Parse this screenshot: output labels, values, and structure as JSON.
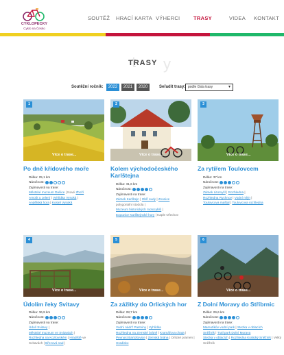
{
  "logo": {
    "text": "CYKLOPECKY",
    "subtext": "Cyklo na Česko"
  },
  "nav": [
    "SOUTĚŽ",
    "HRACÍ KARTA",
    "VÝHERCI",
    "TRASY",
    "VIDEA",
    "KONTAKT"
  ],
  "nav_active": "TRASY",
  "colors": {
    "bar1": "#f0d020",
    "bar2": "#c4143c",
    "bar3": "#1fb86a",
    "accent": "#2a8fd6",
    "active_nav": "#c4143c"
  },
  "page_title": "TRASY",
  "filters": {
    "year_label": "Soutěžní ročník:",
    "years": [
      "2022",
      "2021",
      "2020"
    ],
    "active_year": "2022",
    "sort_label": "Seřadit trasy:",
    "sort_value": "podle čísla trasy"
  },
  "cards": [
    {
      "number": "1",
      "more": "Více o trase...",
      "title": "Po dně křídového moře",
      "length": "Délka: 25,1 km",
      "difficulty_label": "Náročnost:",
      "difficulty": 2,
      "sights_label": "Zajímavosti na trase:",
      "sights": [
        [
          {
            "t": "Městské muzeum Dašice",
            "l": true
          },
          {
            "t": " | Nové ",
            "l": false
          },
          {
            "t": "Zboží",
            "l": true
          }
        ],
        [
          {
            "t": "Arnošt u Jelení",
            "l": true
          },
          {
            "t": " | ",
            "l": false
          },
          {
            "t": "Vyhlídka Vysoká",
            "l": true
          },
          {
            "t": " |",
            "l": false
          }
        ],
        [
          {
            "t": "Andělská hora",
            "l": true
          },
          {
            "t": " | ",
            "l": false
          },
          {
            "t": "Kostel Vysoká",
            "l": true
          }
        ]
      ]
    },
    {
      "number": "2",
      "more": "Více o trase...",
      "title": "Kolem východočeského Karlštejna",
      "length": "Délka: 31,6 km",
      "difficulty_label": "Náročnost:",
      "difficulty": 4,
      "sights_label": "Zajímavosti na trase:",
      "sights": [
        [
          {
            "t": "Zámek Karlštejn",
            "l": true
          },
          {
            "t": " | ",
            "l": false
          },
          {
            "t": "Obří sudy",
            "l": true
          },
          {
            "t": " | ",
            "l": false
          },
          {
            "t": "Zvonice",
            "l": true
          }
        ],
        [
          {
            "t": "polygonální stodola",
            "l": false
          },
          {
            "t": " |",
            "l": false
          }
        ],
        [
          {
            "t": "Muzeum historických motocyklů",
            "l": true
          },
          {
            "t": " |",
            "l": false
          }
        ],
        [
          {
            "t": "Expozice Karlštejnské hory",
            "l": true
          },
          {
            "t": " | Kaple Ořechov",
            "l": false
          }
        ]
      ]
    },
    {
      "number": "3",
      "more": "Více o trase...",
      "title": "Za rytířem Toulovcem",
      "length": "Délka: 37 km",
      "difficulty_label": "Náročnost:",
      "difficulty": 3,
      "sights_label": "Zajímavosti na trase:",
      "sights": [
        [
          {
            "t": "Zámek Litomyšl",
            "l": true
          },
          {
            "t": " | ",
            "l": false
          },
          {
            "t": "Rozhledna",
            "l": true
          },
          {
            "t": " |",
            "l": false
          }
        ],
        [
          {
            "t": "Rozhledna Rychnov",
            "l": true
          },
          {
            "t": " | ",
            "l": false
          },
          {
            "t": "Vodní mlýn",
            "l": true
          },
          {
            "t": " |",
            "l": false
          }
        ],
        [
          {
            "t": "Toulovcova maštal",
            "l": true
          },
          {
            "t": " | ",
            "l": false
          },
          {
            "t": "Toulovcova rozhledna",
            "l": true
          }
        ]
      ]
    },
    {
      "number": "4",
      "more": "Více o trase...",
      "title": "Údolím řeky Svitavy",
      "length": "Délka: 36,9 km",
      "difficulty_label": "Náročnost:",
      "difficulty": 3,
      "sights_label": "Zajímavosti na trase:",
      "sights": [
        [
          {
            "t": "Údolí Svitavy",
            "l": true
          },
          {
            "t": " |",
            "l": false
          }
        ],
        [
          {
            "t": "Městské muzeum ve Svitavách",
            "l": true
          },
          {
            "t": " |",
            "l": false
          }
        ],
        [
          {
            "t": "Rozhledna na Kozlovském",
            "l": true
          },
          {
            "t": " | ",
            "l": false
          },
          {
            "t": "Hradiště",
            "l": true
          },
          {
            "t": " ve",
            "l": false
          }
        ],
        [
          {
            "t": "Svitavách",
            "l": false
          },
          {
            "t": " | ",
            "l": false
          },
          {
            "t": "Březová nad",
            "l": true
          },
          {
            "t": " |",
            "l": false
          }
        ]
      ]
    },
    {
      "number": "5",
      "more": "Více o trase...",
      "title": "Za zážitky do Orlických hor",
      "length": "Délka: 28,7 km",
      "difficulty_label": "Náročnost:",
      "difficulty": 4,
      "sights_label": "Zajímavosti na trase:",
      "sights": [
        [
          {
            "t": "Vodní nádrž Pastviny",
            "l": true
          },
          {
            "t": " | ",
            "l": false
          },
          {
            "t": "Vyhlídka",
            "l": true
          }
        ],
        [
          {
            "t": "Rozhledna na Zemské bráně",
            "l": true
          },
          {
            "t": " | ",
            "l": false
          },
          {
            "t": "Kramářova chata",
            "l": true
          },
          {
            "t": " |",
            "l": false
          }
        ],
        [
          {
            "t": "Pevnost Bartošovice",
            "l": true
          },
          {
            "t": " | ",
            "l": false
          },
          {
            "t": "Zemská brána",
            "l": true
          },
          {
            "t": " | Orlické pramen |",
            "l": false
          }
        ],
        [
          {
            "t": "Hradisko",
            "l": true
          }
        ]
      ]
    },
    {
      "number": "6",
      "more": "Více o trase...",
      "title": "Z Dolní Moravy do Stříbrnic",
      "length": "Délka: 29,6 km",
      "difficulty_label": "Náročnost:",
      "difficulty": 4,
      "sights_label": "Zajímavosti na trase:",
      "sights": [
        [
          {
            "t": "Mamutíkův vodní park",
            "l": true
          },
          {
            "t": " | ",
            "l": false
          },
          {
            "t": "Stezka v oblacích",
            "l": true
          }
        ],
        [
          {
            "t": "Sněžník",
            "l": true
          },
          {
            "t": " | ",
            "l": false
          },
          {
            "t": "Trail park Dolní Morava",
            "l": true
          }
        ],
        [
          {
            "t": "Stezka v oblacích",
            "l": true
          },
          {
            "t": " | ",
            "l": false
          },
          {
            "t": "Rozhledna Kralický Sněžník",
            "l": true
          },
          {
            "t": " | Velký",
            "l": false
          }
        ],
        [
          {
            "t": "Sněžník",
            "l": false
          }
        ]
      ]
    }
  ]
}
